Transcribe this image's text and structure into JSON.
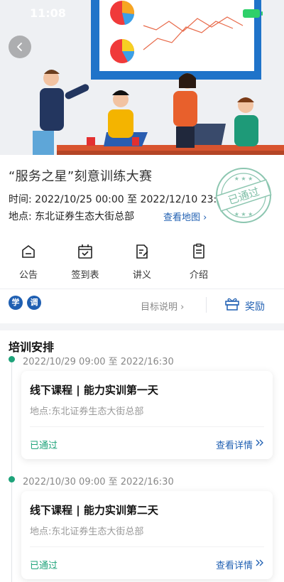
{
  "status_bar": {
    "time": "11:08"
  },
  "event": {
    "title": "“服务之星”刻意训练大赛",
    "time_label": "时间:",
    "time_value": "2022/10/25 00:00 至 2022/12/10 23:30",
    "location_label": "地点:",
    "location_value": "东北证券生态大街总部",
    "map_link": "查看地图",
    "stamp_text": "已通过"
  },
  "menu": [
    {
      "label": "公告",
      "icon": "announcement-icon"
    },
    {
      "label": "签到表",
      "icon": "calendar-check-icon"
    },
    {
      "label": "讲义",
      "icon": "notes-icon"
    },
    {
      "label": "介绍",
      "icon": "document-icon"
    }
  ],
  "tags": [
    "学",
    "调"
  ],
  "actions": {
    "target_link": "目标说明",
    "reward": "奖励"
  },
  "schedule": {
    "title": "培训安排",
    "items": [
      {
        "time": "2022/10/29 09:00 至 2022/16:30",
        "title": "线下课程 |  能力实训第一天",
        "location": "地点:东北证券生态大街总部",
        "status": "已通过",
        "detail": "查看详情"
      },
      {
        "time": "2022/10/30 09:00 至 2022/16:30",
        "title": "线下课程 |  能力实训第二天",
        "location": "地点:东北证券生态大街总部",
        "status": "已通过",
        "detail": "查看详情"
      }
    ]
  },
  "colors": {
    "accent": "#1f5fb2",
    "success": "#1ea37a",
    "stamp": "#7fbfa7"
  }
}
